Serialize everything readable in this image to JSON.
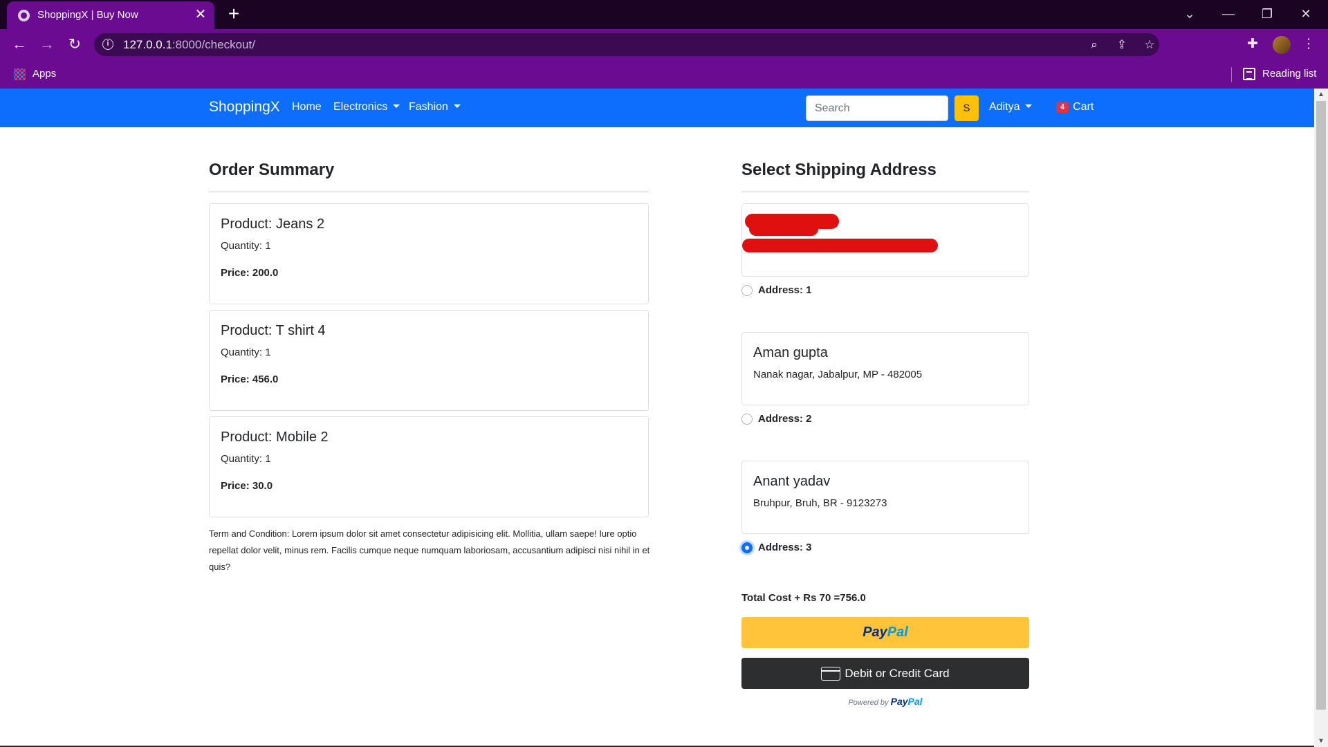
{
  "browser": {
    "tab_title": "ShoppingX | Buy Now",
    "tab_close": "✕",
    "new_tab": "+",
    "url_host": "127.0.0.1",
    "url_path": ":8000/checkout/",
    "bookmarks": {
      "apps_label": "Apps",
      "reading_list_label": "Reading list"
    },
    "icons": [
      "back-arrow-icon",
      "forward-arrow-icon",
      "reload-icon",
      "info-icon",
      "zoom-icon",
      "share-icon",
      "star-icon",
      "extensions-icon",
      "menu-icon"
    ]
  },
  "navbar": {
    "brand": "ShoppingX",
    "links": {
      "home": "Home",
      "electronics": "Electronics",
      "fashion": "Fashion"
    },
    "search_placeholder": "Search",
    "search_button": "S",
    "user": "Aditya",
    "cart_count": "4",
    "cart_label": "Cart",
    "color": "#0d6efd"
  },
  "order_summary": {
    "heading": "Order Summary",
    "items": [
      {
        "product": "Product: Jeans 2",
        "quantity": "Quantity: 1",
        "price": "Price: 200.0"
      },
      {
        "product": "Product: T shirt 4",
        "quantity": "Quantity: 1",
        "price": "Price: 456.0"
      },
      {
        "product": "Product: Mobile 2",
        "quantity": "Quantity: 1",
        "price": "Price: 30.0"
      }
    ],
    "terms": "Term and Condition: Lorem ipsum dolor sit amet consectetur adipisicing elit. Mollitia, ullam saepe! Iure optio repellat dolor velit, minus rem. Facilis cumque neque numquam laboriosam, accusantium adipisci nisi nihil in et quis?"
  },
  "shipping": {
    "heading": "Select Shipping Address",
    "addresses": [
      {
        "name": "",
        "line": "",
        "label": "Address: 1",
        "selected": false
      },
      {
        "name": "Aman gupta",
        "line": "Nanak nagar, Jabalpur, MP - 482005",
        "label": "Address: 2",
        "selected": false
      },
      {
        "name": "Anant yadav",
        "line": "Bruhpur, Bruh, BR - 9123273",
        "label": "Address: 3",
        "selected": true
      }
    ],
    "total": "Total Cost + Rs 70 =756.0",
    "paypal_part1": "Pay",
    "paypal_part2": "Pal",
    "card_button": "Debit or Credit Card",
    "powered_by": "Powered by",
    "powered_logo_1": "Pay",
    "powered_logo_2": "Pal"
  }
}
